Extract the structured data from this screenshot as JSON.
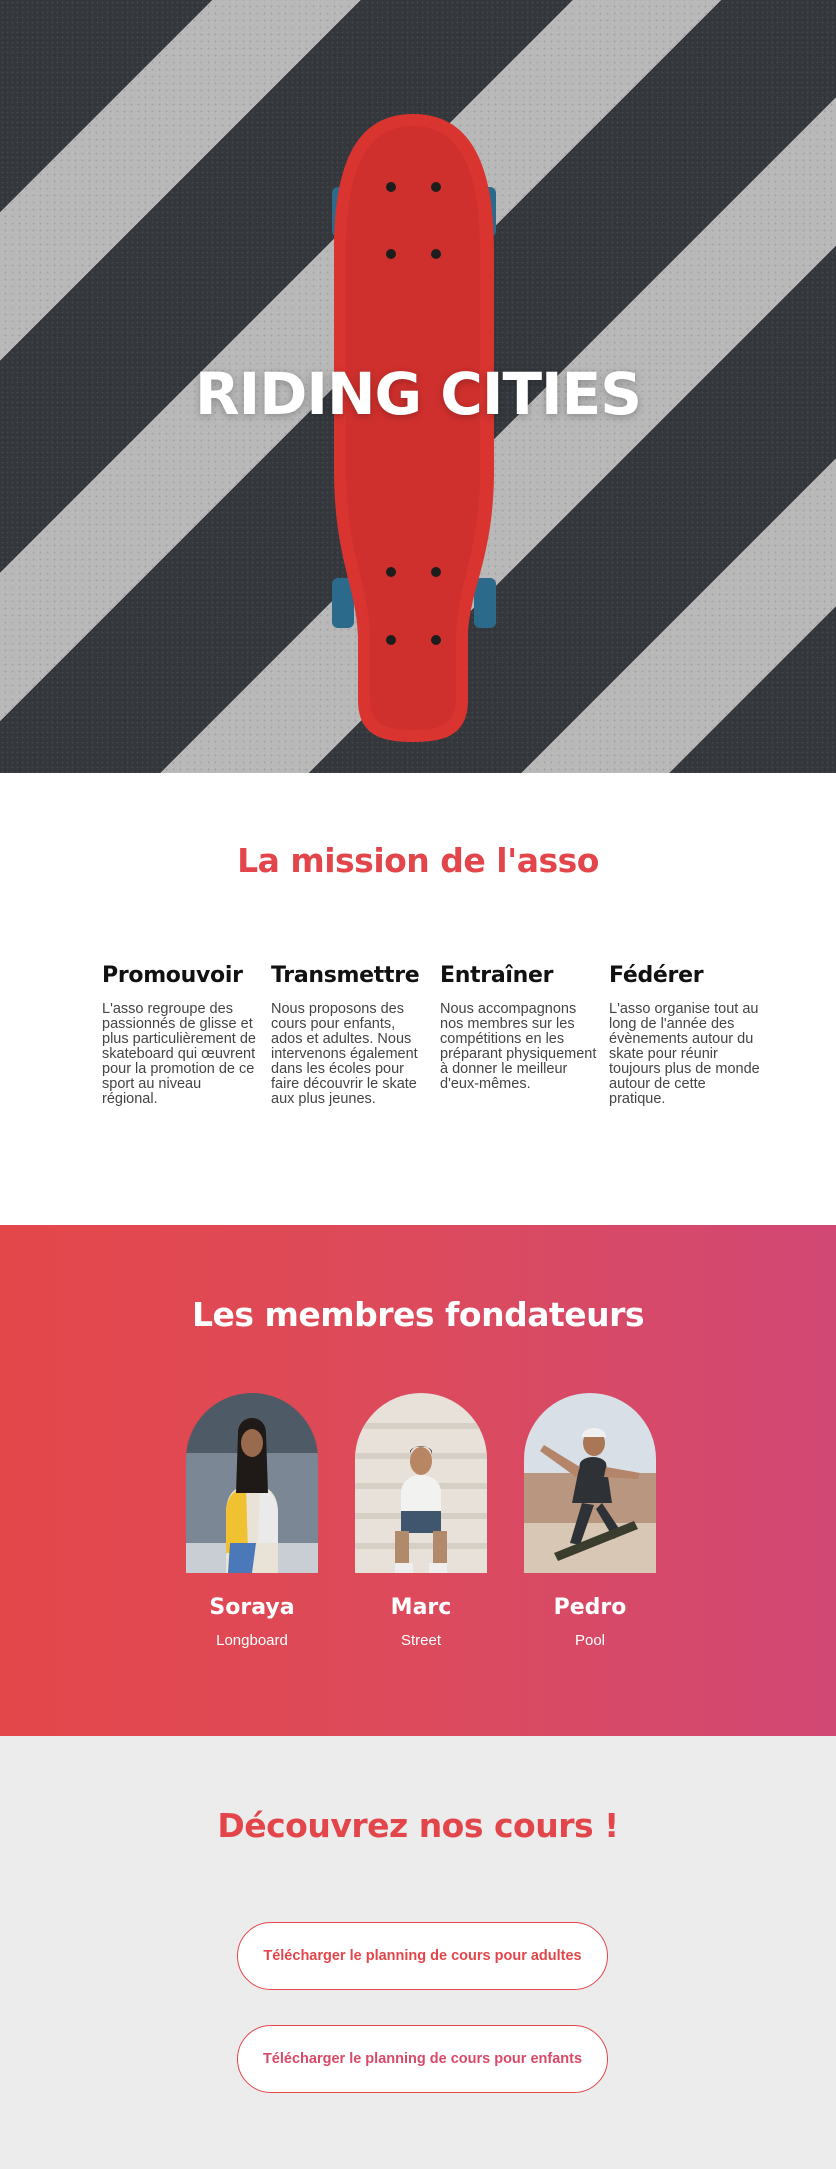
{
  "hero": {
    "title": "RIDING CITIES"
  },
  "mission": {
    "title": "La mission de l'asso",
    "pillars": [
      {
        "heading": "Promouvoir",
        "text": "L'asso regroupe des passionnés de glisse et plus particulièrement de skateboard qui œuvrent pour la promotion de ce sport au niveau régional."
      },
      {
        "heading": "Transmettre",
        "text": "Nous proposons des cours pour enfants, ados et adultes. Nous intervenons également dans les écoles pour faire découvrir le skate aux plus jeunes."
      },
      {
        "heading": "Entraîner",
        "text": "Nous accompagnons nos membres sur les compétitions en les préparant physiquement à donner le meilleur d'eux-mêmes."
      },
      {
        "heading": "Fédérer",
        "text": "L'asso organise tout au long de l'année des évènements autour du skate pour réunir toujours plus de monde autour de cette pratique."
      }
    ]
  },
  "members": {
    "title": "Les membres fondateurs",
    "list": [
      {
        "name": "Soraya",
        "style": "Longboard"
      },
      {
        "name": "Marc",
        "style": "Street"
      },
      {
        "name": "Pedro",
        "style": "Pool"
      }
    ]
  },
  "courses": {
    "title": "Découvrez nos cours !",
    "adults_button": "Télécharger le planning de cours pour adultes",
    "kids_button": "Télécharger le planning de cours pour enfants"
  },
  "colors": {
    "accent": "#e2464a",
    "gradient_start": "#e4474a",
    "gradient_end": "#d14875",
    "courses_bg": "#ececec"
  }
}
